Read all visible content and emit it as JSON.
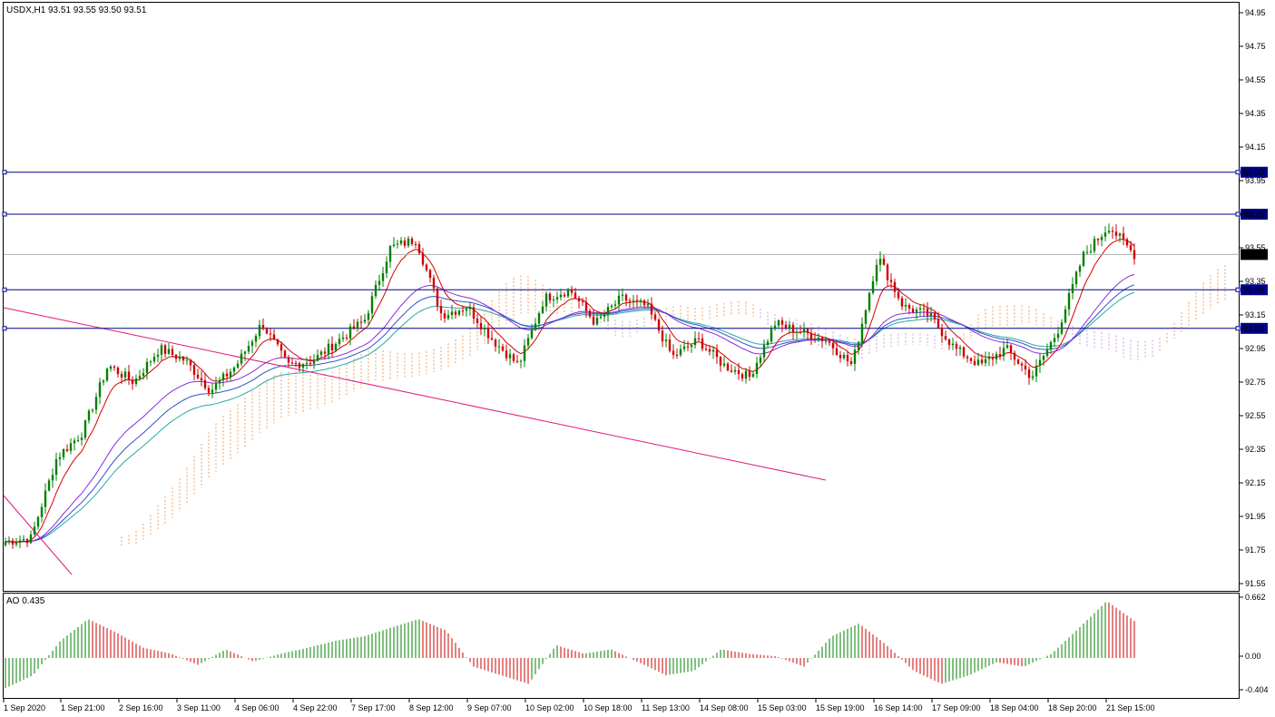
{
  "header": {
    "symbol": "USDX,H1",
    "ohlc": "93.51 93.55 93.50 93.51"
  },
  "indicator": {
    "label": "AO 0.435",
    "scale_labels": [
      "0.662",
      "0.00",
      "-0.404"
    ]
  },
  "colors": {
    "bull": "#008000",
    "bear": "#cc0000",
    "level_line": "#00008b",
    "trendline": "#e0197d",
    "ma_fast": "#d50000",
    "ma_purple": "#8a2be2",
    "ma_teal": "#2aa7a7",
    "ma_blue": "#3050c8",
    "cloud_orange": "#f0a060",
    "cloud_violet": "#c8a0d8"
  },
  "chart_data": {
    "type": "candlestick",
    "price_axis_labels": [
      "94.95",
      "94.75",
      "94.55",
      "94.35",
      "94.15",
      "93.95",
      "93.75",
      "93.55",
      "93.35",
      "93.15",
      "92.95",
      "92.75",
      "92.55",
      "92.35",
      "92.15",
      "91.95",
      "91.75",
      "91.55"
    ],
    "ylim": [
      91.5,
      95.0
    ],
    "horizontal_levels": [
      94.0,
      93.75,
      93.3,
      93.07
    ],
    "level_labels": [
      "94.00",
      "93.75",
      "93.30",
      "93.07"
    ],
    "current_price": 93.51,
    "current_price_label": "93.51",
    "time_labels": [
      "1 Sep 2020",
      "1 Sep 21:00",
      "2 Sep 16:00",
      "3 Sep 11:00",
      "4 Sep 06:00",
      "4 Sep 22:00",
      "7 Sep 17:00",
      "8 Sep 12:00",
      "9 Sep 07:00",
      "10 Sep 02:00",
      "10 Sep 18:00",
      "11 Sep 13:00",
      "14 Sep 08:00",
      "15 Sep 03:00",
      "15 Sep 19:00",
      "16 Sep 14:00",
      "17 Sep 09:00",
      "18 Sep 04:00",
      "18 Sep 20:00",
      "21 Sep 15:00"
    ],
    "close_path": [
      91.8,
      91.82,
      92.3,
      92.45,
      92.85,
      92.75,
      92.95,
      92.88,
      92.7,
      92.85,
      93.1,
      92.85,
      92.88,
      93.0,
      93.12,
      93.55,
      93.6,
      93.15,
      93.2,
      93.0,
      92.85,
      93.25,
      93.3,
      93.1,
      93.25,
      93.2,
      92.9,
      93.0,
      92.85,
      92.78,
      93.1,
      93.05,
      93.0,
      92.85,
      93.5,
      93.2,
      93.15,
      92.95,
      92.85,
      92.95,
      92.78,
      93.05,
      93.5,
      93.68,
      93.51
    ],
    "ao_range": [
      -0.404,
      0.662
    ],
    "ao_path": [
      -0.35,
      -0.2,
      0.2,
      0.45,
      0.3,
      0.12,
      0.05,
      -0.08,
      0.1,
      -0.04,
      0.05,
      0.12,
      0.2,
      0.25,
      0.35,
      0.45,
      0.32,
      -0.1,
      -0.2,
      -0.3,
      0.15,
      0.05,
      0.1,
      -0.05,
      -0.2,
      -0.15,
      0.1,
      0.05,
      0.02,
      -0.1,
      0.25,
      0.4,
      0.15,
      -0.15,
      -0.3,
      -0.2,
      -0.05,
      -0.1,
      0.05,
      0.35,
      0.66,
      0.43
    ],
    "trendlines": [
      {
        "from": [
          "1 Sep 2020",
          93.2
        ],
        "to": [
          "14 Sep 08:00",
          92.2
        ]
      },
      {
        "from": [
          "1 Sep 2020",
          92.05
        ],
        "to": [
          "1 Sep 21:00",
          91.6
        ]
      }
    ]
  }
}
